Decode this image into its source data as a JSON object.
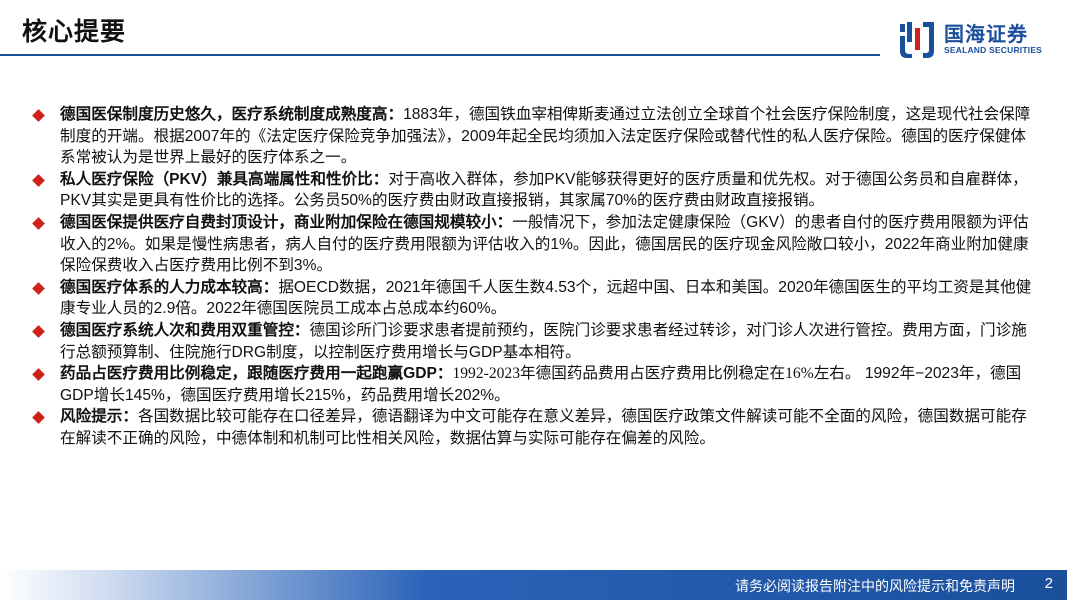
{
  "page_title": "核心提要",
  "logo": {
    "name_cn": "国海证券",
    "name_en": "SEALAND SECURITIES",
    "brand_color": "#1a4f9c"
  },
  "bullet_color": "#d1211b",
  "bullets": [
    {
      "lead": "德国医保制度历史悠久，医疗系统制度成熟度高：",
      "text": "1883年，德国铁血宰相俾斯麦通过立法创立全球首个社会医疗保险制度，这是现代社会保障制度的开端。根据2007年的《法定医疗保险竞争加强法》，2009年起全民均须加入法定医疗保险或替代性的私人医疗保险。德国的医疗保健体系常被认为是世界上最好的医疗体系之一。"
    },
    {
      "lead": "私人医疗保险（PKV）兼具高端属性和性价比：",
      "text": "对于高收入群体，参加PKV能够获得更好的医疗质量和优先权。对于德国公务员和自雇群体，PKV其实是更具有性价比的选择。公务员50%的医疗费由财政直接报销，其家属70%的医疗费由财政直接报销。"
    },
    {
      "lead": "德国医保提供医疗自费封顶设计，商业附加保险在德国规模较小：",
      "text": "一般情况下，参加法定健康保险（GKV）的患者自付的医疗费用限额为评估收入的2%。如果是慢性病患者，病人自付的医疗费用限额为评估收入的1%。因此，德国居民的医疗现金风险敞口较小，2022年商业附加健康保险保费收入占医疗费用比例不到3%。"
    },
    {
      "lead": "德国医疗体系的人力成本较高：",
      "text": "据OECD数据，2021年德国千人医生数4.53个，远超中国、日本和美国。2020年德国医生的平均工资是其他健康专业人员的2.9倍。2022年德国医院员工成本占总成本约60%。"
    },
    {
      "lead": "德国医疗系统人次和费用双重管控：",
      "text": "德国诊所门诊要求患者提前预约，医院门诊要求患者经过转诊，对门诊人次进行管控。费用方面，门诊施行总额预算制、住院施行DRG制度，以控制医疗费用增长与GDP基本相符。"
    },
    {
      "lead": "药品占医疗费用比例稳定，跟随医疗费用一起跑赢GDP：",
      "text_serif": "1992-2023年德国药品费用占医疗费用比例稳定在16%左右。",
      "text": " 1992年−2023年，德国GDP增长145%，德国医疗费用增长215%，药品费用增长202%。"
    },
    {
      "lead": "风险提示：",
      "text": "各国数据比较可能存在口径差异，德语翻译为中文可能存在意义差异，德国医疗政策文件解读可能不全面的风险，德国数据可能存在解读不正确的风险，中德体制和机制可比性相关风险，数据估算与实际可能存在偏差的风险。"
    }
  ],
  "footer": {
    "disclaimer": "请务必阅读报告附注中的风险提示和免责声明",
    "page_number": "2"
  }
}
